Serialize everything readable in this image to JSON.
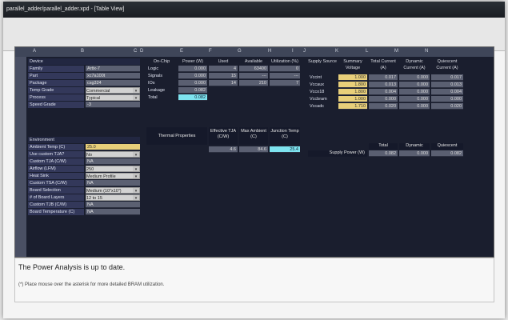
{
  "window": {
    "title": "parallel_adder/parallel_adder.xpd - [Table View]"
  },
  "columns": [
    "A",
    "B",
    "C",
    "D",
    "E",
    "F",
    "G",
    "H",
    "I",
    "J",
    "K",
    "L",
    "M",
    "N"
  ],
  "device": {
    "header": "Device",
    "rows": [
      {
        "label": "Family",
        "value": "Artix-7"
      },
      {
        "label": "Part",
        "value": "xc7a100t"
      },
      {
        "label": "Package",
        "value": "csg324"
      },
      {
        "label": "Temp Grade",
        "value": "Commercial"
      },
      {
        "label": "Process",
        "value": "Typical"
      },
      {
        "label": "Speed Grade",
        "value": "-3"
      }
    ]
  },
  "environment": {
    "header": "Environment",
    "rows": [
      {
        "label": "Ambient Temp (C)",
        "value": "25.0"
      },
      {
        "label": "Use custom TJA?",
        "value": "No"
      },
      {
        "label": "Custom TJA (C/W)",
        "value": "NA"
      },
      {
        "label": "Airflow (LFM)",
        "value": "250"
      },
      {
        "label": "Heat Sink",
        "value": "Medium Profile"
      },
      {
        "label": "Custom TSA (C/W)",
        "value": "NA"
      },
      {
        "label": "Board Selection",
        "value": "Medium (10\"x10\")"
      },
      {
        "label": "# of Board Layers",
        "value": "12 to 15"
      },
      {
        "label": "Custom TJB (C/W)",
        "value": "NA"
      },
      {
        "label": "Board Temperature (C)",
        "value": "NA"
      }
    ]
  },
  "onchip": {
    "headers": [
      "On-Chip",
      "Power (W)",
      "Used",
      "Available",
      "Utilization (%)"
    ],
    "rows": [
      {
        "name": "Logic",
        "power": "0.000",
        "used": "4",
        "avail": "63400",
        "util": "0"
      },
      {
        "name": "Signals",
        "power": "0.000",
        "used": "15",
        "avail": "---",
        "util": "---"
      },
      {
        "name": "IOs",
        "power": "0.000",
        "used": "14",
        "avail": "210",
        "util": "7"
      },
      {
        "name": "Leakage",
        "power": "0.082",
        "used": "",
        "avail": "",
        "util": ""
      },
      {
        "name": "Total",
        "power": "0.082",
        "used": "",
        "avail": "",
        "util": ""
      }
    ]
  },
  "supply": {
    "headers": [
      "Supply Source",
      "Summary Voltage",
      "Total Current (A)",
      "Dynamic Current (A)",
      "Quiescent Current (A)"
    ],
    "rows": [
      {
        "src": "Vccint",
        "volt": "1.000",
        "total": "0.017",
        "dyn": "0.000",
        "q": "0.017"
      },
      {
        "src": "Vccaux",
        "volt": "1.800",
        "total": "0.013",
        "dyn": "0.000",
        "q": "0.013"
      },
      {
        "src": "Vcco18",
        "volt": "1.800",
        "total": "0.004",
        "dyn": "0.000",
        "q": "0.004"
      },
      {
        "src": "Vccbram",
        "volt": "1.000",
        "total": "0.000",
        "dyn": "0.000",
        "q": "0.000"
      },
      {
        "src": "Vccadc",
        "volt": "1.710",
        "total": "0.020",
        "dyn": "0.000",
        "q": "0.020"
      }
    ]
  },
  "thermal": {
    "label": "Thermal Properties",
    "headers": [
      "Effective TJA (C/W)",
      "Max Ambient (C)",
      "Junction Temp (C)"
    ],
    "values": [
      "4.6",
      "84.6",
      "25.4"
    ]
  },
  "power_summary": {
    "label": "Supply Power (W)",
    "headers": [
      "Total",
      "Dynamic",
      "Quiescent"
    ],
    "values": [
      "0.082",
      "0.000",
      "0.082"
    ]
  },
  "status": {
    "message": "The Power Analysis is up to date.",
    "note": "(*) Place mouse over the asterisk for more detailed BRAM utilization."
  },
  "colors": {
    "grid_bg": "#1a1e2e",
    "highlight_yellow": "#e8cf7a",
    "highlight_cyan": "#7ee3ef"
  }
}
